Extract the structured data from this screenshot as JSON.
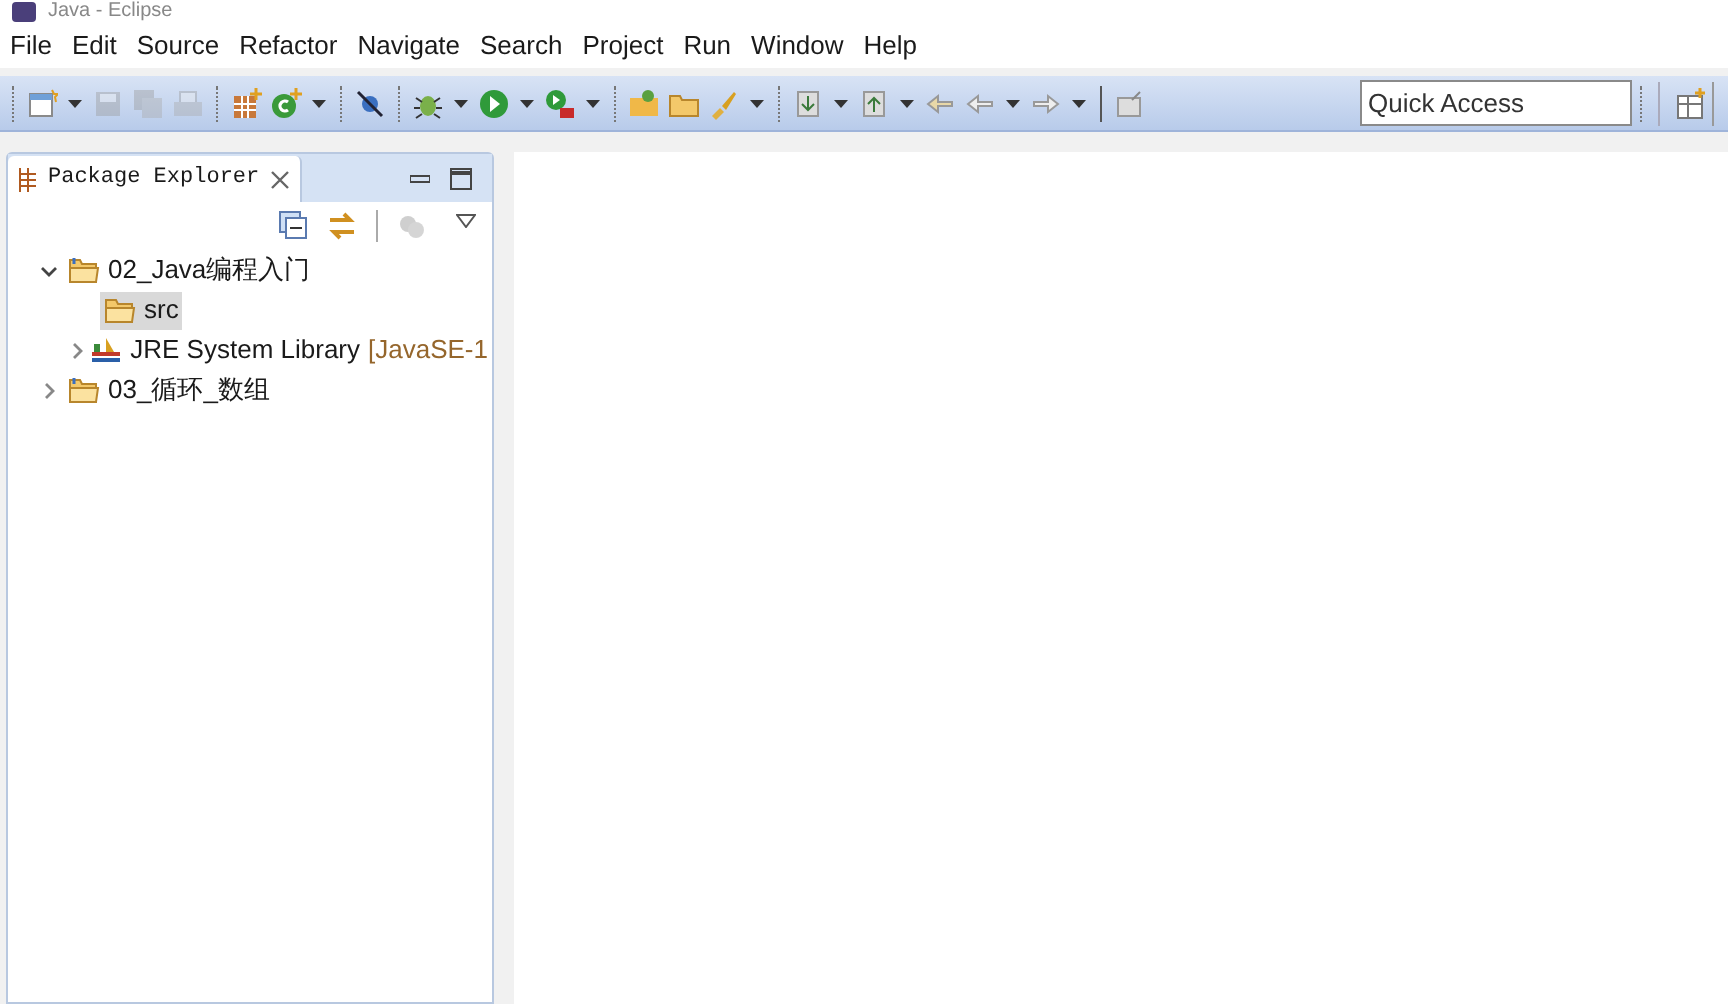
{
  "window": {
    "title": "Java - Eclipse"
  },
  "menu": [
    "File",
    "Edit",
    "Source",
    "Refactor",
    "Navigate",
    "Search",
    "Project",
    "Run",
    "Window",
    "Help"
  ],
  "quick_access": {
    "placeholder": "Quick Access"
  },
  "view": {
    "title": "Package Explorer"
  },
  "tree": [
    {
      "label": "02_Java编程入门",
      "kind": "project",
      "expanded": true,
      "selected": false,
      "children": [
        {
          "label": "src",
          "kind": "source",
          "selected": true
        },
        {
          "label": "JRE System Library",
          "decoration": "[JavaSE-1",
          "kind": "library",
          "expanded": false,
          "selected": false
        }
      ]
    },
    {
      "label": "03_循环_数组",
      "kind": "project",
      "expanded": false,
      "selected": false
    }
  ]
}
